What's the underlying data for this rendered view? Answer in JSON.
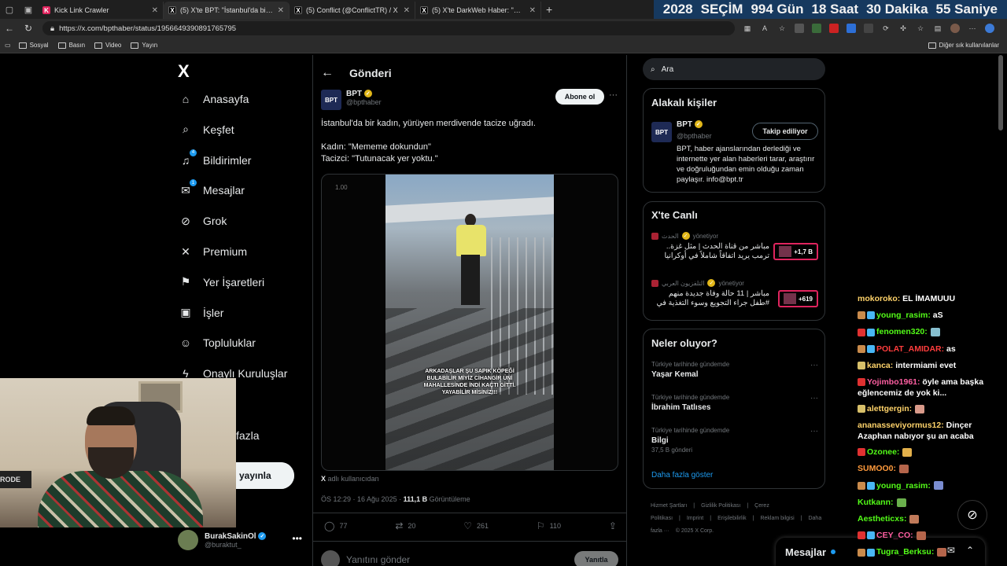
{
  "browser": {
    "tabs": [
      {
        "title": "Kick Link Crawler",
        "fav_color": "#e0245e",
        "fav_text": "K",
        "active": false
      },
      {
        "title": "(5) X'te BPT: \"İstanbul'da bir kadın...",
        "fav_color": "#000000",
        "fav_text": "X",
        "active": true
      },
      {
        "title": "(5) Conflict (@ConflictTR) / X",
        "fav_color": "#000000",
        "fav_text": "X",
        "active": false
      },
      {
        "title": "(5) X'te DarkWeb Haber: \"Polisler...",
        "fav_color": "#000000",
        "fav_text": "X",
        "active": false
      }
    ],
    "url": "https://x.com/bpthaber/status/1956649390891765795",
    "bookmarks": [
      "Sosyal",
      "Basın",
      "Video",
      "Yayın"
    ],
    "bookmarks_other": "Diğer sık kullanılanlar"
  },
  "countdown": {
    "year": "2028",
    "label": "SEÇİM",
    "days": "994 Gün",
    "hours": "18 Saat",
    "minutes": "30 Dakika",
    "seconds": "55 Saniye"
  },
  "sidebar": {
    "logo": "X",
    "items": [
      {
        "label": "Anasayfa",
        "icon": "home-icon",
        "glyph": "⌂"
      },
      {
        "label": "Keşfet",
        "icon": "search-icon",
        "glyph": "⌕"
      },
      {
        "label": "Bildirimler",
        "icon": "bell-icon",
        "glyph": "♫",
        "badge": "4"
      },
      {
        "label": "Mesajlar",
        "icon": "mail-icon",
        "glyph": "✉",
        "badge": "1"
      },
      {
        "label": "Grok",
        "icon": "grok-icon",
        "glyph": "⊘"
      },
      {
        "label": "Premium",
        "icon": "x-premium-icon",
        "glyph": "✕"
      },
      {
        "label": "Yer İşaretleri",
        "icon": "bookmark-icon",
        "glyph": "⚑"
      },
      {
        "label": "İşler",
        "icon": "briefcase-icon",
        "glyph": "▣"
      },
      {
        "label": "Topluluklar",
        "icon": "communities-icon",
        "glyph": "☺"
      },
      {
        "label": "Onaylı Kuruluşlar",
        "icon": "lightning-icon",
        "glyph": "ϟ"
      }
    ],
    "more_label": "fazla",
    "post_label": "yayınla",
    "account": {
      "name": "BurakSakinOl",
      "handle": "@buraktut_"
    }
  },
  "main": {
    "header_title": "Gönderi",
    "author": {
      "avatar_text": "BPT",
      "name": "BPT",
      "handle": "@bpthaber"
    },
    "subscribe_label": "Abone ol",
    "text_lines": [
      "İstanbul'da bir kadın, yürüyen merdivende tacize uğradı.",
      "",
      "Kadın: \"Mememe dokundun\"",
      "Tacizci: \"Tutunacak yer yoktu.\""
    ],
    "video_speed": "1.00",
    "video_caption": "ARKADAŞLAR ŞU SAPIK KÖPEĞİ BULABİLİR MİYİZ CİHANGİR ÜNİ MAHALLESİNDE İNDİ KAÇTI GİTTİ. YAYABİLİR MİSİNİZ!!!",
    "source_x": "X",
    "source_text": "adlı kullanıcıdan",
    "meta_time": "ÖS 12:29 · 16 Ağu 2025 · ",
    "meta_views": "111,1 B",
    "meta_views_label": "Görüntüleme",
    "actions": [
      {
        "icon": "reply-icon",
        "glyph": "◯",
        "count": "77"
      },
      {
        "icon": "retweet-icon",
        "glyph": "⇄",
        "count": "20"
      },
      {
        "icon": "heart-icon",
        "glyph": "♡",
        "count": "261"
      },
      {
        "icon": "bookmark-icon",
        "glyph": "⚐",
        "count": "110"
      },
      {
        "icon": "share-icon",
        "glyph": "⇪",
        "count": ""
      }
    ],
    "reply_placeholder": "Yanıtını gönder",
    "reply_button": "Yanıtla"
  },
  "right": {
    "search_placeholder": "Ara",
    "relevant": {
      "title": "Alakalı kişiler",
      "avatar_text": "BPT",
      "name": "BPT",
      "handle": "@bpthaber",
      "follow_label": "Takip ediliyor",
      "bio": "BPT, haber ajanslarından derlediği ve internette yer alan haberleri tarar, araştırır ve doğruluğundan emin olduğu zaman paylaşır. info@bpt.tr"
    },
    "live": {
      "title": "X'te Canlı",
      "items": [
        {
          "host": "الحدث",
          "host_suffix": "yönetiyor",
          "title": "مباشر من قناة الحدث | مثل غزة.. ترمب يريد اتفاقاً شاملاً في أوكرانيا",
          "count": "+1,7 B"
        },
        {
          "host": "التلفزيون العربي",
          "host_suffix": "yönetiyor",
          "title": "مباشر | 11 حالة وفاة جديدة منهم #طفل جراء التجويع وسوء التغذية في",
          "count": "+619"
        }
      ]
    },
    "trends": {
      "title": "Neler oluyor?",
      "items": [
        {
          "category": "Türkiye tarihinde gündemde",
          "name": "Yaşar Kemal",
          "count": ""
        },
        {
          "category": "Türkiye tarihinde gündemde",
          "name": "İbrahim Tatlıses",
          "count": ""
        },
        {
          "category": "Türkiye tarihinde gündemde",
          "name": "Bilgi",
          "count": "37,5 B gönderi"
        }
      ],
      "show_more": "Daha fazla göster"
    },
    "footer": [
      "Hizmet Şartları",
      "|",
      "Gizlilik Politikası",
      "|",
      "Çerez Politikası",
      "|",
      "Imprint",
      "|",
      "Erişilebilirlik",
      "|",
      "Reklam bilgisi",
      "|",
      "Daha fazla ···",
      "© 2025 X Corp."
    ],
    "dm_title": "Mesajlar"
  },
  "chat": {
    "messages": [
      {
        "user": "mokoroko",
        "color": "#ffd36a",
        "text": "EL İMAMUUU",
        "badges": []
      },
      {
        "user": "young_rasim",
        "color": "#53fc18",
        "text": "aS",
        "badges": [
          "#c98b4c",
          "#49b7f5"
        ]
      },
      {
        "user": "fenomen320",
        "color": "#53fc18",
        "text": "",
        "badges": [
          "#e03131",
          "#49b7f5"
        ],
        "emote": "#87c0d0"
      },
      {
        "user": "POLAT_AMIDAR",
        "color": "#ff3d3d",
        "text": "as",
        "badges": [
          "#c98b4c",
          "#49b7f5"
        ]
      },
      {
        "user": "kanca",
        "color": "#ffd36a",
        "text": "intermiami evet",
        "badges": [
          "#d8c06a"
        ]
      },
      {
        "user": "Yojimbo1961",
        "color": "#ff5fa2",
        "text": "öyle ama başka eğlencemiz de yok ki...",
        "badges": [
          "#e03131"
        ]
      },
      {
        "user": "alettgergin",
        "color": "#ffd36a",
        "text": "",
        "badges": [
          "#d8c06a"
        ],
        "emote": "#d99a8a"
      },
      {
        "user": "ananasseviyormus12",
        "color": "#ffd36a",
        "text": "Dinçer Azaphan nabıyor şu an acaba",
        "badges": []
      },
      {
        "user": "Ozonee",
        "color": "#53fc18",
        "text": "",
        "badges": [
          "#e03131"
        ],
        "emote": "#e3b04b"
      },
      {
        "user": "SUMOO0",
        "color": "#ff9a3c",
        "text": "",
        "badges": [],
        "emote": "#b5654b"
      },
      {
        "user": "young_rasim",
        "color": "#53fc18",
        "text": "",
        "badges": [
          "#c98b4c",
          "#49b7f5"
        ],
        "emote": "#7a8cd0"
      },
      {
        "user": "Kutkann",
        "color": "#53fc18",
        "text": "",
        "badges": [],
        "emote": "#6ab04c"
      },
      {
        "user": "Aestheticxs",
        "color": "#53fc18",
        "text": "",
        "badges": [],
        "emote": "#c07a5a"
      },
      {
        "user": "CEY_CO",
        "color": "#ff5fa2",
        "text": "",
        "badges": [
          "#e03131",
          "#49b7f5"
        ],
        "emote": "#b5654b"
      },
      {
        "user": "Tugra_Berksu",
        "color": "#53fc18",
        "text": "",
        "badges": [
          "#c98b4c",
          "#49b7f5"
        ],
        "emote": "#b5654b"
      }
    ]
  }
}
